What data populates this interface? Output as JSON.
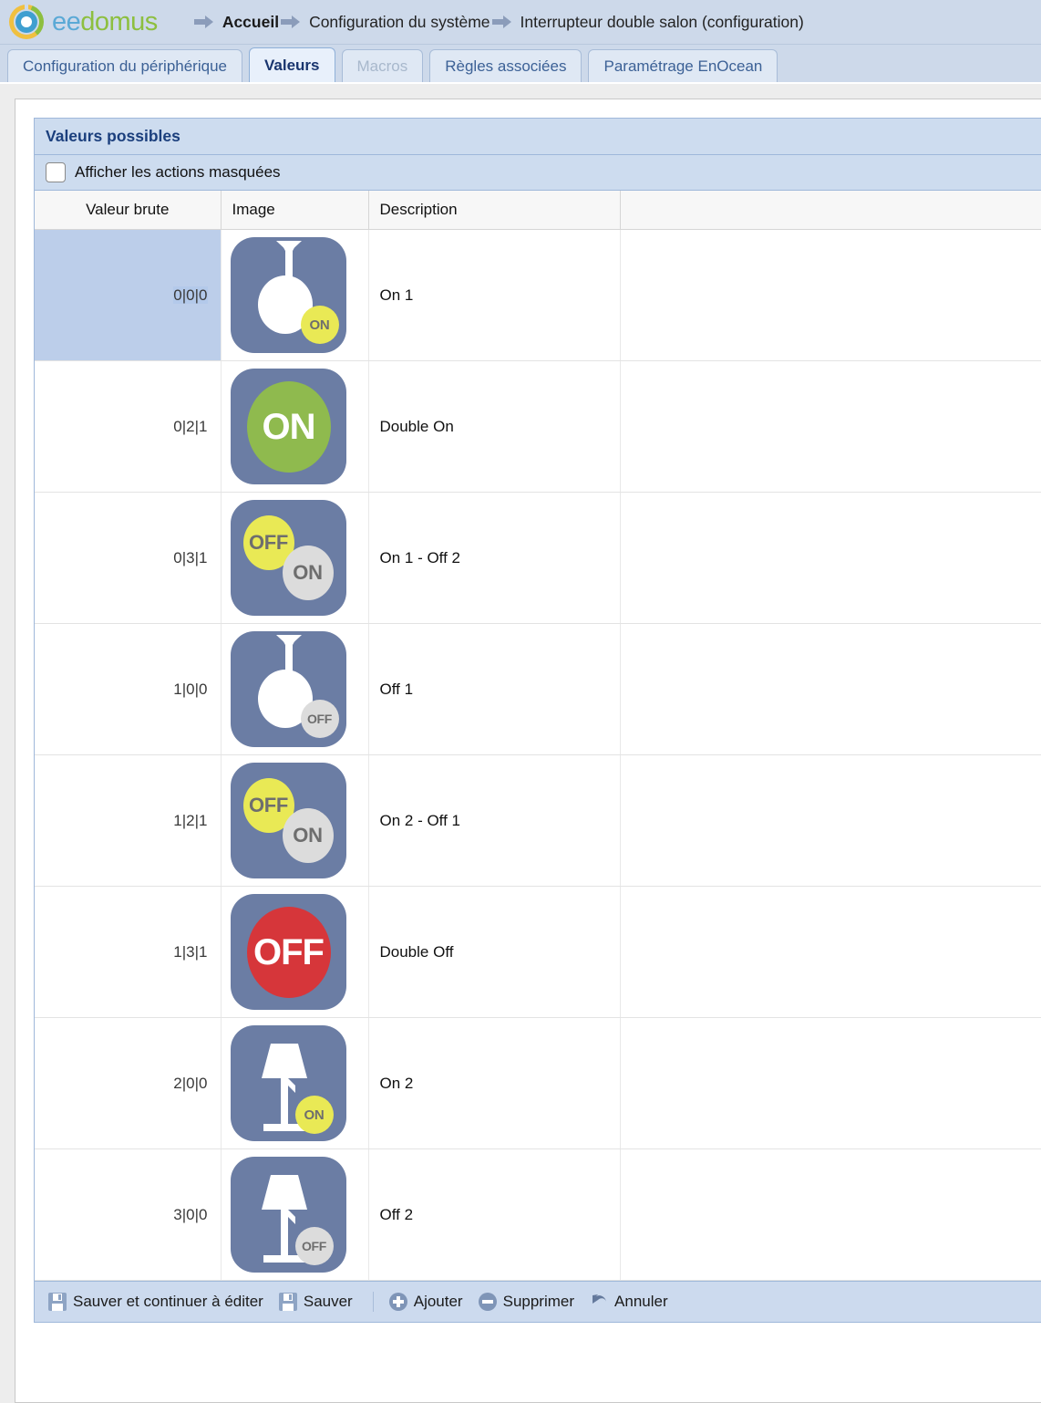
{
  "header": {
    "brand": {
      "ee": "ee",
      "domus": "domus"
    },
    "breadcrumb": [
      {
        "label": "Accueil",
        "current": true
      },
      {
        "label": "Configuration du système",
        "current": false
      },
      {
        "label": "Interrupteur double salon (configuration)",
        "current": false
      }
    ]
  },
  "tabs": [
    {
      "label": "Configuration du périphérique",
      "state": "normal"
    },
    {
      "label": "Valeurs",
      "state": "active"
    },
    {
      "label": "Macros",
      "state": "disabled"
    },
    {
      "label": "Règles associées",
      "state": "normal"
    },
    {
      "label": "Paramétrage EnOcean",
      "state": "normal"
    }
  ],
  "panel": {
    "title": "Valeurs possibles",
    "show_hidden_label": "Afficher les actions masquées",
    "show_hidden_checked": false
  },
  "table": {
    "headers": [
      "Valeur brute",
      "Image",
      "Description"
    ],
    "rows": [
      {
        "raw": "0|0|0",
        "description": "On 1",
        "icon": "pendant-lamp-on-icon",
        "selected": true
      },
      {
        "raw": "0|2|1",
        "description": "Double On",
        "icon": "double-on-icon",
        "selected": false
      },
      {
        "raw": "0|3|1",
        "description": "On 1 - Off 2",
        "icon": "off-on-badges-icon",
        "selected": false
      },
      {
        "raw": "1|0|0",
        "description": "Off 1",
        "icon": "pendant-lamp-off-icon",
        "selected": false
      },
      {
        "raw": "1|2|1",
        "description": "On 2 - Off 1",
        "icon": "off-on-badges-icon",
        "selected": false
      },
      {
        "raw": "1|3|1",
        "description": "Double Off",
        "icon": "double-off-icon",
        "selected": false
      },
      {
        "raw": "2|0|0",
        "description": "On 2",
        "icon": "floor-lamp-on-icon",
        "selected": false
      },
      {
        "raw": "3|0|0",
        "description": "Off 2",
        "icon": "floor-lamp-off-icon",
        "selected": false
      }
    ]
  },
  "badges": {
    "on": "ON",
    "off": "OFF"
  },
  "toolbar": {
    "save_continue": "Sauver et continuer à éditer",
    "save": "Sauver",
    "add": "Ajouter",
    "delete": "Supprimer",
    "cancel": "Annuler"
  },
  "colors": {
    "header_bg": "#cdd9ea",
    "tab_active_bg": "#e8f0fb",
    "block_header_bg": "#cddcef",
    "row_selected_bg": "#bcceea",
    "tile_bg": "#6b7da4",
    "badge_yellow": "#e9e955",
    "badge_grey": "#dcdcdc",
    "on_green": "#8fba4e",
    "off_red": "#d6363a",
    "logo_green": "#8dbf3f",
    "logo_blue": "#5aa9d6",
    "logo_yellow": "#f0c040"
  }
}
